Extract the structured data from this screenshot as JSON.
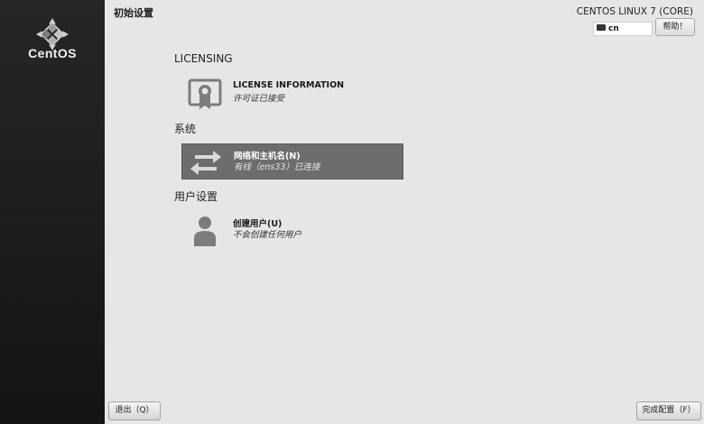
{
  "sidebar": {
    "logo_text": "CentOS"
  },
  "header": {
    "title": "初始设置",
    "product": "CENTOS LINUX 7 (CORE)",
    "keyboard_layout": "cn",
    "help_label": "帮助！"
  },
  "sections": [
    {
      "title": "LICENSING",
      "spokes": [
        {
          "name": "LICENSE INFORMATION",
          "status": "许可证已接受",
          "icon": "certificate-icon"
        }
      ]
    },
    {
      "title": "系统",
      "spokes": [
        {
          "name": "网络和主机名(N)",
          "status": "有线（ens33）已连接",
          "icon": "network-arrows-icon",
          "selected": true
        }
      ]
    },
    {
      "title": "用户设置",
      "spokes": [
        {
          "name": "创建用户(U)",
          "status": "不会创建任何用户",
          "icon": "user-icon"
        }
      ]
    }
  ],
  "footer": {
    "quit_label": "退出（Q）",
    "finish_label": "完成配置（F）"
  },
  "colors": {
    "sidebar": "#1e1e1e",
    "background": "#e6e6e6",
    "selected_spoke": "#6d6d6d"
  }
}
